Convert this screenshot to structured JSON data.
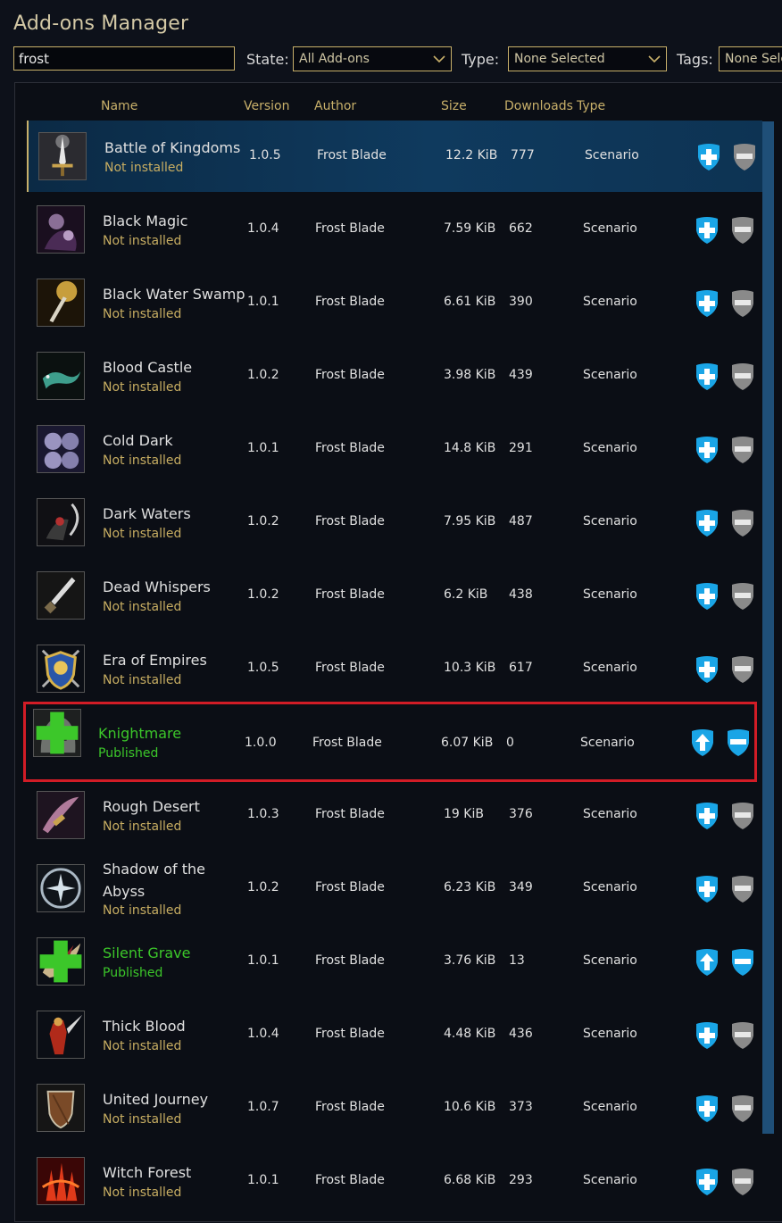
{
  "window": {
    "title": "Add-ons Manager"
  },
  "filters": {
    "search_value": "frost",
    "state_label": "State:",
    "state_value": "All Add-ons",
    "type_label": "Type:",
    "type_value": "None Selected",
    "tags_label": "Tags:",
    "tags_value": "None Sele"
  },
  "columns": {
    "name": "Name",
    "version": "Version",
    "author": "Author",
    "size": "Size",
    "downloads": "Downloads",
    "type": "Type"
  },
  "colors": {
    "accent_gold": "#c8b06a",
    "published_green": "#3cc72a",
    "action_blue": "#1aa5e6",
    "action_gray": "#8a8a8a",
    "highlight_red": "#d21c26"
  },
  "addons": [
    {
      "name": "Battle of Kingdoms",
      "status": "Not installed",
      "version": "1.0.5",
      "author": "Frost Blade",
      "size": "12.2 KiB",
      "downloads": "777",
      "type": "Scenario",
      "icon": "sword-icon",
      "published": false
    },
    {
      "name": "Black Magic",
      "status": "Not installed",
      "version": "1.0.4",
      "author": "Frost Blade",
      "size": "7.59 KiB",
      "downloads": "662",
      "type": "Scenario",
      "icon": "dark-mage-icon",
      "published": false
    },
    {
      "name": "Black Water Swamp",
      "status": "Not installed",
      "version": "1.0.1",
      "author": "Frost Blade",
      "size": "6.61 KiB",
      "downloads": "390",
      "type": "Scenario",
      "icon": "torch-icon",
      "published": false
    },
    {
      "name": "Blood Castle",
      "status": "Not installed",
      "version": "1.0.2",
      "author": "Frost Blade",
      "size": "3.98 KiB",
      "downloads": "439",
      "type": "Scenario",
      "icon": "lizard-icon",
      "published": false
    },
    {
      "name": "Cold Dark",
      "status": "Not installed",
      "version": "1.0.1",
      "author": "Frost Blade",
      "size": "14.8 KiB",
      "downloads": "291",
      "type": "Scenario",
      "icon": "skulls-icon",
      "published": false
    },
    {
      "name": "Dark Waters",
      "status": "Not installed",
      "version": "1.0.2",
      "author": "Frost Blade",
      "size": "7.95 KiB",
      "downloads": "487",
      "type": "Scenario",
      "icon": "reaper-icon",
      "published": false
    },
    {
      "name": "Dead Whispers",
      "status": "Not installed",
      "version": "1.0.2",
      "author": "Frost Blade",
      "size": "6.2 KiB",
      "downloads": "438",
      "type": "Scenario",
      "icon": "dagger-icon",
      "published": false
    },
    {
      "name": "Era of Empires",
      "status": "Not installed",
      "version": "1.0.5",
      "author": "Frost Blade",
      "size": "10.3 KiB",
      "downloads": "617",
      "type": "Scenario",
      "icon": "shield-crest-icon",
      "published": false
    },
    {
      "name": "Knightmare",
      "status": "Published",
      "version": "1.0.0",
      "author": "Frost Blade",
      "size": "6.07 KiB",
      "downloads": "0",
      "type": "Scenario",
      "icon": "hooded-knight-icon",
      "published": true
    },
    {
      "name": "Rough Desert",
      "status": "Not installed",
      "version": "1.0.3",
      "author": "Frost Blade",
      "size": "19 KiB",
      "downloads": "376",
      "type": "Scenario",
      "icon": "scimitar-icon",
      "published": false
    },
    {
      "name": "Shadow of the Abyss",
      "status": "Not installed",
      "version": "1.0.2",
      "author": "Frost Blade",
      "size": "6.23 KiB",
      "downloads": "349",
      "type": "Scenario",
      "icon": "frost-emblem-icon",
      "published": false
    },
    {
      "name": "Silent Grave",
      "status": "Published",
      "version": "1.0.1",
      "author": "Frost Blade",
      "size": "3.76 KiB",
      "downloads": "13",
      "type": "Scenario",
      "icon": "bone-dragon-icon",
      "published": true
    },
    {
      "name": "Thick Blood",
      "status": "Not installed",
      "version": "1.0.4",
      "author": "Frost Blade",
      "size": "4.48 KiB",
      "downloads": "436",
      "type": "Scenario",
      "icon": "red-warrior-icon",
      "published": false
    },
    {
      "name": "United Journey",
      "status": "Not installed",
      "version": "1.0.7",
      "author": "Frost Blade",
      "size": "10.6 KiB",
      "downloads": "373",
      "type": "Scenario",
      "icon": "wooden-shield-icon",
      "published": false
    },
    {
      "name": "Witch Forest",
      "status": "Not installed",
      "version": "1.0.1",
      "author": "Frost Blade",
      "size": "6.68 KiB",
      "downloads": "293",
      "type": "Scenario",
      "icon": "fire-forest-icon",
      "published": false
    }
  ]
}
